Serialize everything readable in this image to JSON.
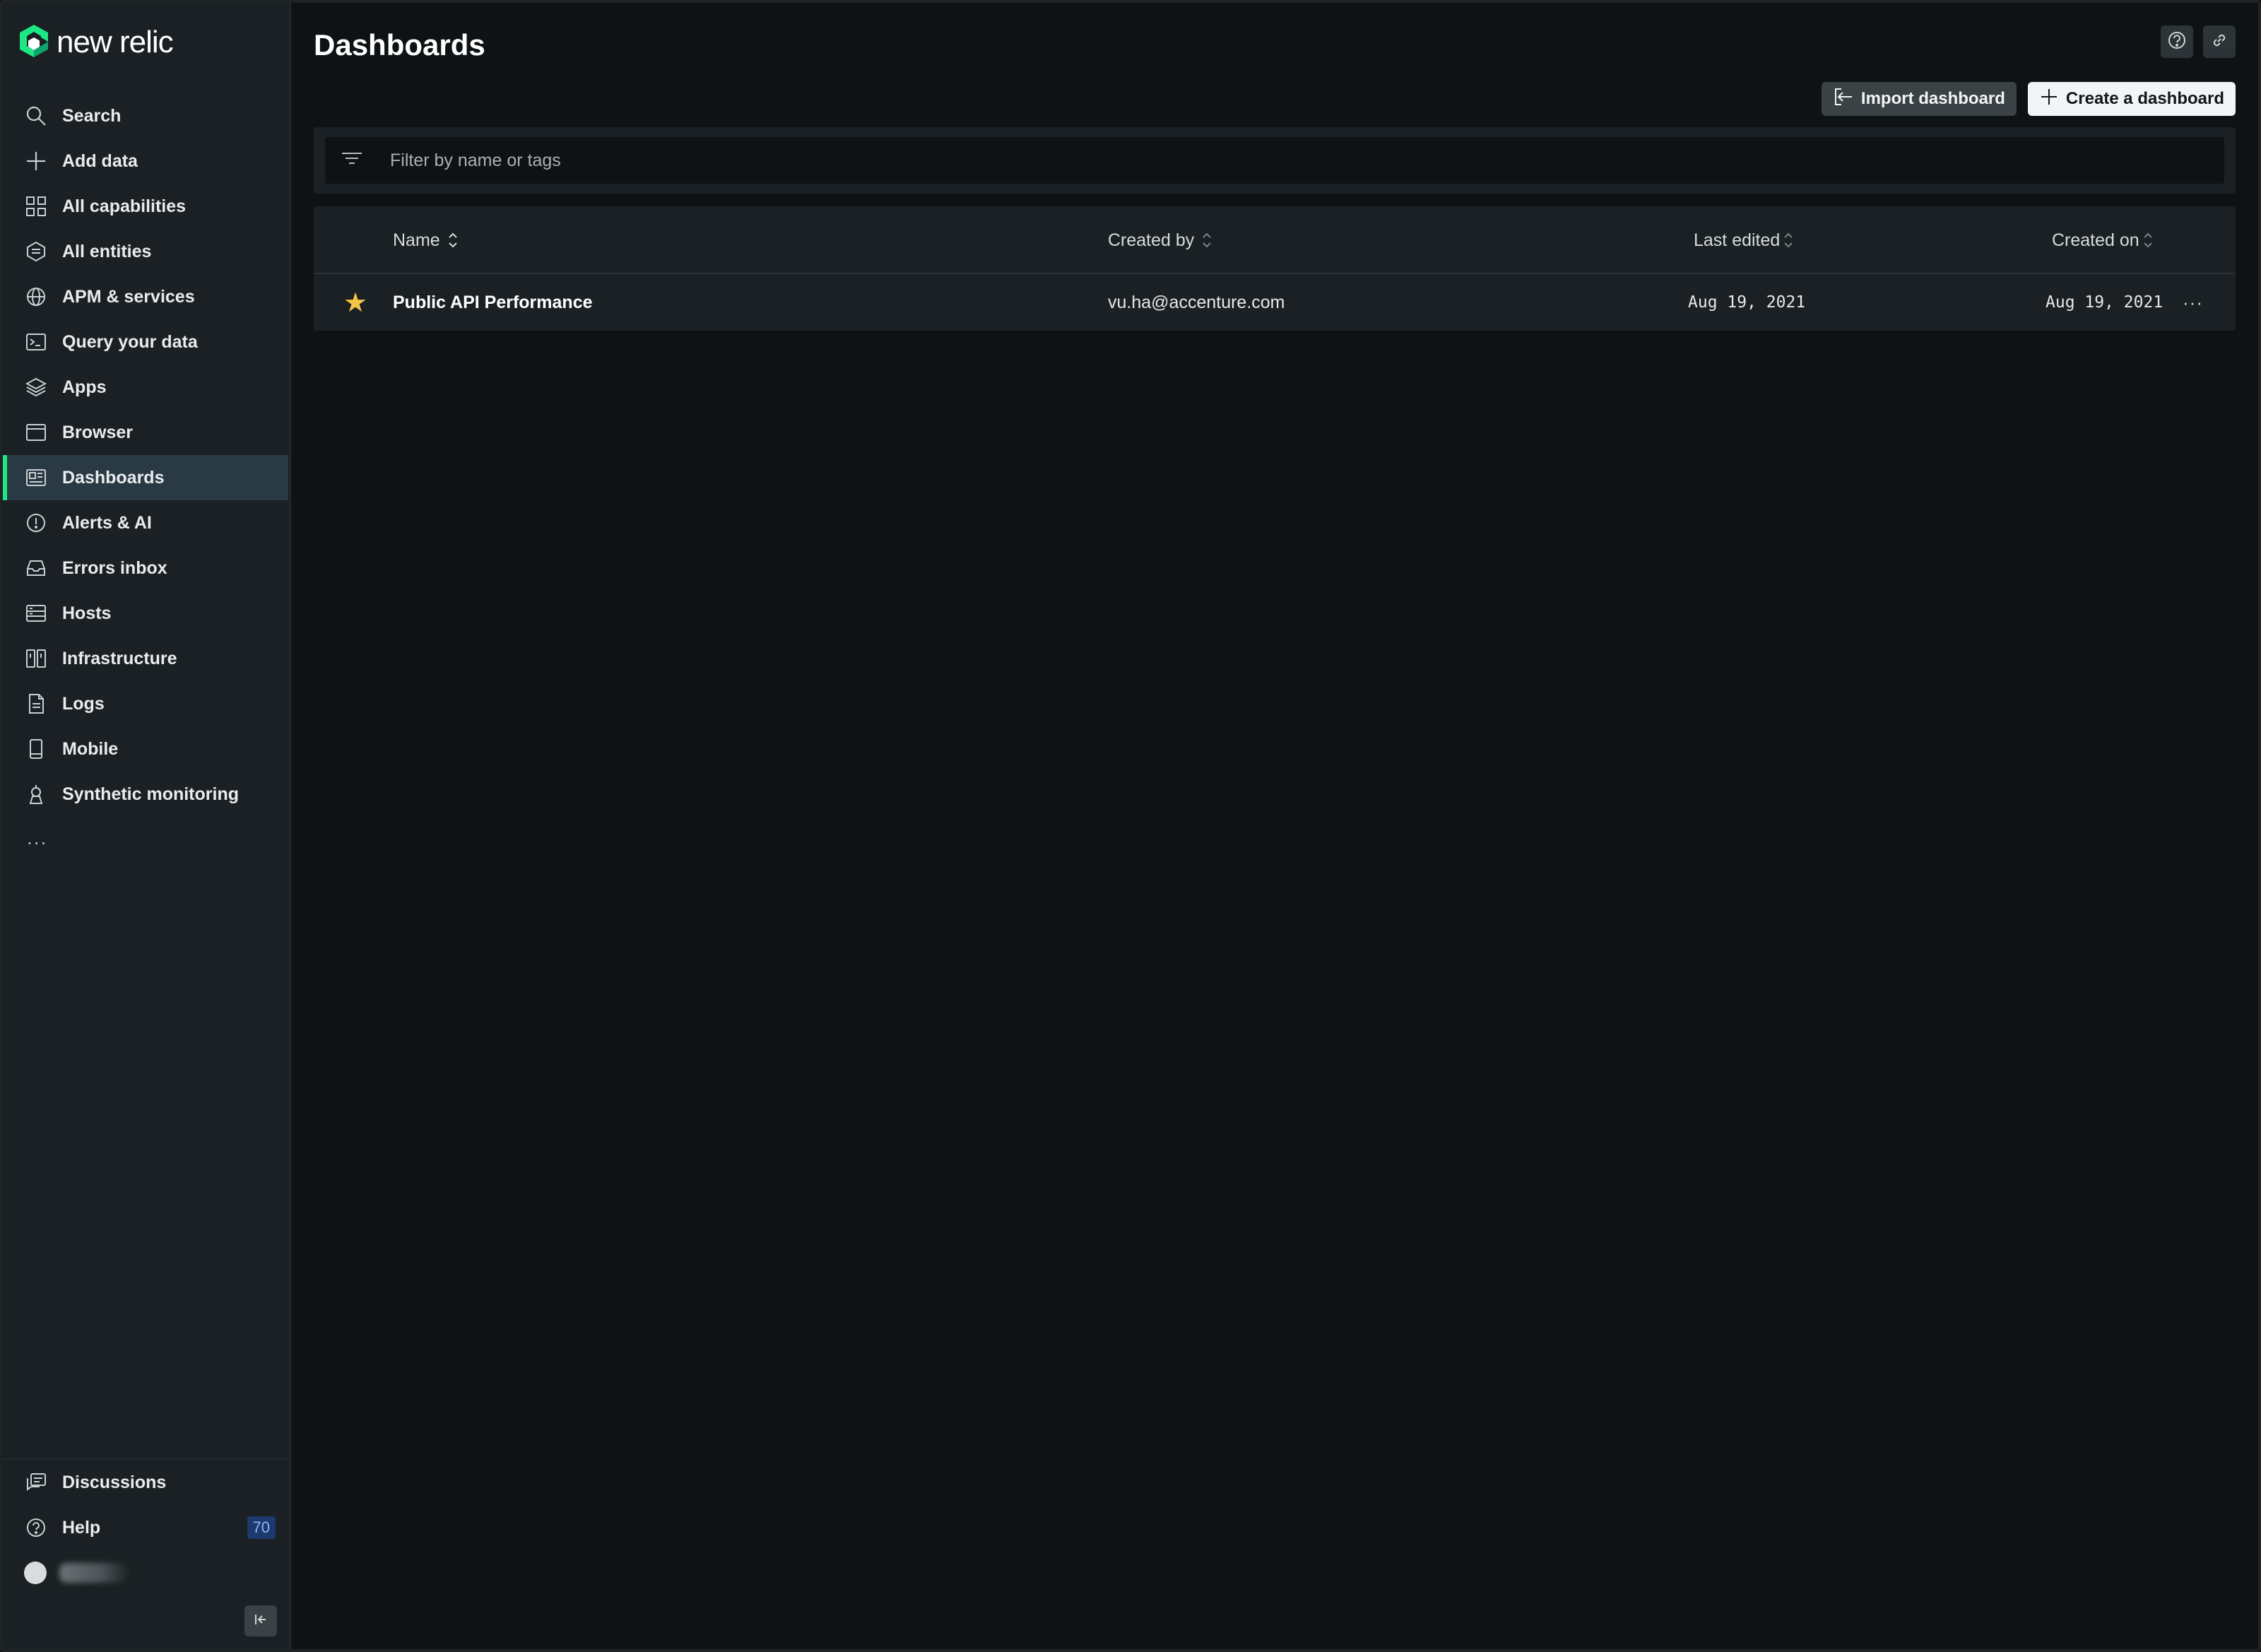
{
  "brand": {
    "name": "new relic",
    "accent": "#1ce783"
  },
  "sidebar": {
    "items": [
      {
        "label": "Search",
        "icon": "search-icon"
      },
      {
        "label": "Add data",
        "icon": "plus-icon"
      },
      {
        "label": "All capabilities",
        "icon": "grid-icon"
      },
      {
        "label": "All entities",
        "icon": "entities-icon"
      },
      {
        "label": "APM & services",
        "icon": "globe-icon"
      },
      {
        "label": "Query your data",
        "icon": "terminal-icon"
      },
      {
        "label": "Apps",
        "icon": "layers-icon"
      },
      {
        "label": "Browser",
        "icon": "browser-icon"
      },
      {
        "label": "Dashboards",
        "icon": "dashboard-icon",
        "active": true
      },
      {
        "label": "Alerts & AI",
        "icon": "alert-icon"
      },
      {
        "label": "Errors inbox",
        "icon": "inbox-icon"
      },
      {
        "label": "Hosts",
        "icon": "hosts-icon"
      },
      {
        "label": "Infrastructure",
        "icon": "infrastructure-icon"
      },
      {
        "label": "Logs",
        "icon": "logs-icon"
      },
      {
        "label": "Mobile",
        "icon": "mobile-icon"
      },
      {
        "label": "Synthetic monitoring",
        "icon": "synthetic-icon"
      }
    ],
    "more_label": "...",
    "bottom": {
      "discussions_label": "Discussions",
      "help_label": "Help",
      "help_badge": "70"
    }
  },
  "header": {
    "title": "Dashboards",
    "import_label": "Import dashboard",
    "create_label": "Create a dashboard"
  },
  "filter": {
    "placeholder": "Filter by name or tags"
  },
  "table": {
    "columns": [
      "Name",
      "Created by",
      "Last edited",
      "Created on"
    ],
    "rows": [
      {
        "starred": true,
        "name": "Public API Performance",
        "created_by": "vu.ha@accenture.com",
        "last_edited": "Aug 19, 2021",
        "created_on": "Aug 19, 2021"
      }
    ],
    "row_menu_label": "···"
  }
}
